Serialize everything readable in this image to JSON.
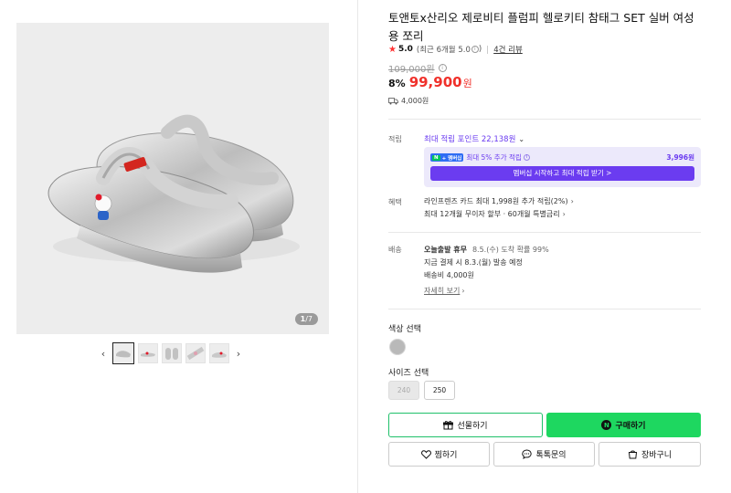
{
  "gallery": {
    "counter_current": "1",
    "counter_total": "/7",
    "prev_icon": "chevron-left-icon",
    "next_icon": "chevron-right-icon",
    "thumbnail_count": 5
  },
  "product": {
    "title": "토앤토x산리오 제로비티 플럼피 헬로키티 참태그 SET 실버 여성용 쪼리",
    "star": "★",
    "score": "5.0",
    "recent_score": "(최근 6개월 5.0",
    "recent_close": ")",
    "reviews": "4건 리뷰",
    "original_price": "109,000원",
    "discount_rate": "8%",
    "price": "99,900",
    "currency": "원",
    "shipping_fee": "4,000원"
  },
  "points": {
    "label": "적립",
    "max": "최대 적립 포인트 22,138원",
    "member_badge_n": "N",
    "member_badge_text": "+ 멤버십",
    "member_text": "최대 5% 추가 적립",
    "member_amount": "3,996원",
    "member_button": "멤버십 시작하고 최대 적립 받기 >"
  },
  "benefits": {
    "label": "혜택",
    "line1": "라인프렌즈 카드 최대 1,998원 추가 적립(2%)",
    "line2": "최대 12개월 무이자 할부 · 60개월 특별금리"
  },
  "delivery": {
    "label": "배송",
    "today": "오늘출발 휴무",
    "arrival": "8.5.(수) 도착 확률 99%",
    "dispatch": "지금 결제 시 8.3.(월) 발송 예정",
    "fee": "배송비 4,000원",
    "detail_link": "자세히 보기"
  },
  "options": {
    "color_label": "색상 선택",
    "size_label": "사이즈 선택",
    "sizes": [
      "240",
      "250"
    ],
    "swatch_color": "#b9b9b9"
  },
  "actions": {
    "gift": "선물하기",
    "buy": "구매하기",
    "wish": "찜하기",
    "talk": "톡톡문의",
    "cart": "장바구니",
    "buy_color": "#1ed760"
  },
  "colors": {
    "price_red": "#f0302a",
    "membership_purple": "#6b3cf0"
  }
}
